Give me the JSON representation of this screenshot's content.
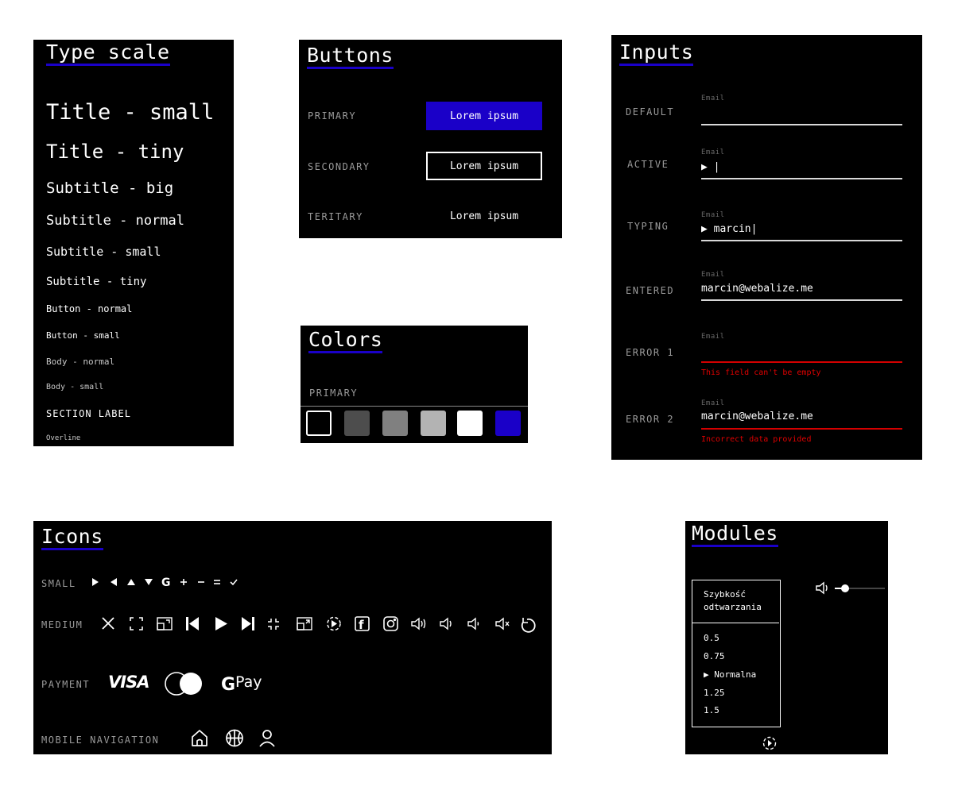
{
  "type_scale": {
    "title": "Type scale",
    "items": [
      "Title - small",
      "Title - tiny",
      "Subtitle - big",
      "Subtitle - normal",
      "Subtitle - small",
      "Subtitle - tiny",
      "Button - normal",
      "Button - small",
      "Body - normal",
      "Body - small",
      "SECTION LABEL",
      "Overline"
    ]
  },
  "buttons": {
    "title": "Buttons",
    "rows": [
      {
        "label": "PRIMARY",
        "button": "Lorem ipsum"
      },
      {
        "label": "SECONDARY",
        "button": "Lorem ipsum"
      },
      {
        "label": "TERITARY",
        "button": "Lorem ipsum"
      }
    ]
  },
  "colors": {
    "title": "Colors",
    "label": "PRIMARY",
    "swatches": [
      "#000000",
      "#4d4d4d",
      "#808080",
      "#b3b3b3",
      "#ffffff",
      "#1a00c8"
    ]
  },
  "inputs": {
    "title": "Inputs",
    "placeholder": "Email",
    "rows": [
      {
        "state": "DEFAULT",
        "value": ""
      },
      {
        "state": "ACTIVE",
        "value": "▶ |"
      },
      {
        "state": "TYPING",
        "value": "▶ marcin|"
      },
      {
        "state": "ENTERED",
        "value": "marcin@webalize.me"
      },
      {
        "state": "ERROR 1",
        "value": "",
        "error": "This field can't be empty"
      },
      {
        "state": "ERROR 2",
        "value": "marcin@webalize.me",
        "error": "Incorrect data provided"
      }
    ]
  },
  "icons": {
    "title": "Icons",
    "small_label": "SMALL",
    "medium_label": "MEDIUM",
    "payment_label": "PAYMENT",
    "mobile_label": "MOBILE NAVIGATION",
    "small_icons": [
      "play-icon",
      "rewind-icon",
      "up-icon",
      "down-icon",
      "google-icon",
      "plus-icon",
      "minus-icon",
      "equals-icon",
      "check-icon"
    ],
    "medium_icons": [
      "close-icon",
      "fullscreen-icon",
      "pip-icon",
      "skip-back-icon",
      "play-icon",
      "skip-forward-icon",
      "exit-fullscreen-icon",
      "pip-out-icon",
      "speed-icon",
      "facebook-icon",
      "instagram-icon",
      "volume-high-icon",
      "volume-medium-icon",
      "volume-low-icon",
      "mute-icon",
      "replay-icon"
    ],
    "payment": {
      "visa": "VISA",
      "gpay": "Pay"
    },
    "mobile_icons": [
      "home-icon",
      "basketball-icon",
      "user-icon"
    ]
  },
  "modules": {
    "title": "Modules",
    "speed_header": "Szybkość odtwarzania",
    "speeds": [
      "0.5",
      "0.75",
      "▶ Normalna",
      "1.25",
      "1.5"
    ],
    "volume_level": 0.2
  }
}
